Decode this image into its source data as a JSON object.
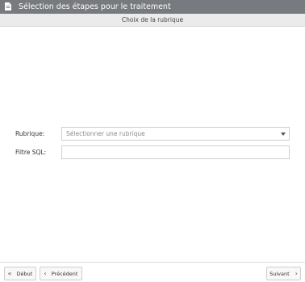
{
  "window": {
    "title": "Sélection des étapes pour le traitement"
  },
  "step": {
    "title": "Choix de la rubrique"
  },
  "form": {
    "rubrique_label": "Rubrique:",
    "rubrique_placeholder": "Sélectionner une rubrique",
    "filtre_label": "Filtre SQL:",
    "filtre_value": ""
  },
  "footer": {
    "debut_label": "Début",
    "precedent_label": "Précédent",
    "suivant_label": "Suivant"
  },
  "icons": {
    "title_icon": "document-icon",
    "debut_icon": "double-chevron-left-icon",
    "precedent_icon": "chevron-left-icon",
    "suivant_icon": "chevron-right-icon",
    "select_icon": "caret-down-icon"
  },
  "colors": {
    "titlebar_bg": "#777a7e",
    "stepbar_bg": "#ebebeb"
  }
}
